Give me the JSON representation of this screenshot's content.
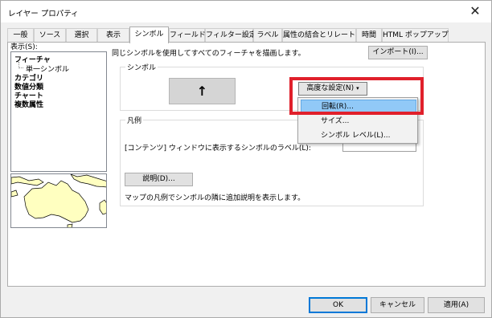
{
  "window": {
    "title": "レイヤー プロパティ",
    "close_glyph": "✕"
  },
  "tabs": [
    "一般",
    "ソース",
    "選択",
    "表示",
    "シンボル",
    "フィールド",
    "フィルター設定",
    "ラベル",
    "属性の結合とリレート",
    "時間",
    "HTML ポップアップ"
  ],
  "active_tab": "シンボル",
  "left_pane": {
    "show_label": "表示(S):",
    "items": [
      {
        "label": "フィーチャ",
        "bold": true,
        "indent": 0
      },
      {
        "label": "単一シンボル",
        "bold": false,
        "indent": 1
      },
      {
        "label": "カテゴリ",
        "bold": true,
        "indent": 0
      },
      {
        "label": "数値分類",
        "bold": true,
        "indent": 0
      },
      {
        "label": "チャート",
        "bold": true,
        "indent": 0
      },
      {
        "label": "複数属性",
        "bold": true,
        "indent": 0
      }
    ],
    "selected_item": "単一シンボル"
  },
  "main": {
    "description": "同じシンボルを使用してすべてのフィーチャを描画します。",
    "import_button": "インポート(I)...",
    "symbol_group_label": "シンボル",
    "symbol_arrow": "↑",
    "advanced_button": "高度な設定(N)",
    "advanced_menu": [
      "回転(R)...",
      "サイズ...",
      "シンボル レベル(L)..."
    ],
    "highlighted_menu_item": "回転(R)...",
    "legend_group_label": "凡例",
    "legend_label_text": "[コンテンツ] ウィンドウに表示するシンボルのラベル(L):",
    "legend_label_value": "",
    "description_button": "説明(D)...",
    "description_note": "マップの凡例でシンボルの隣に追加説明を表示します。"
  },
  "footer": {
    "ok": "OK",
    "cancel": "キャンセル",
    "apply": "適用(A)"
  },
  "colors": {
    "highlight_box": "#e0202b",
    "menu_highlight": "#91c9f7",
    "map_land": "#ffffc0",
    "map_border": "#000000"
  }
}
